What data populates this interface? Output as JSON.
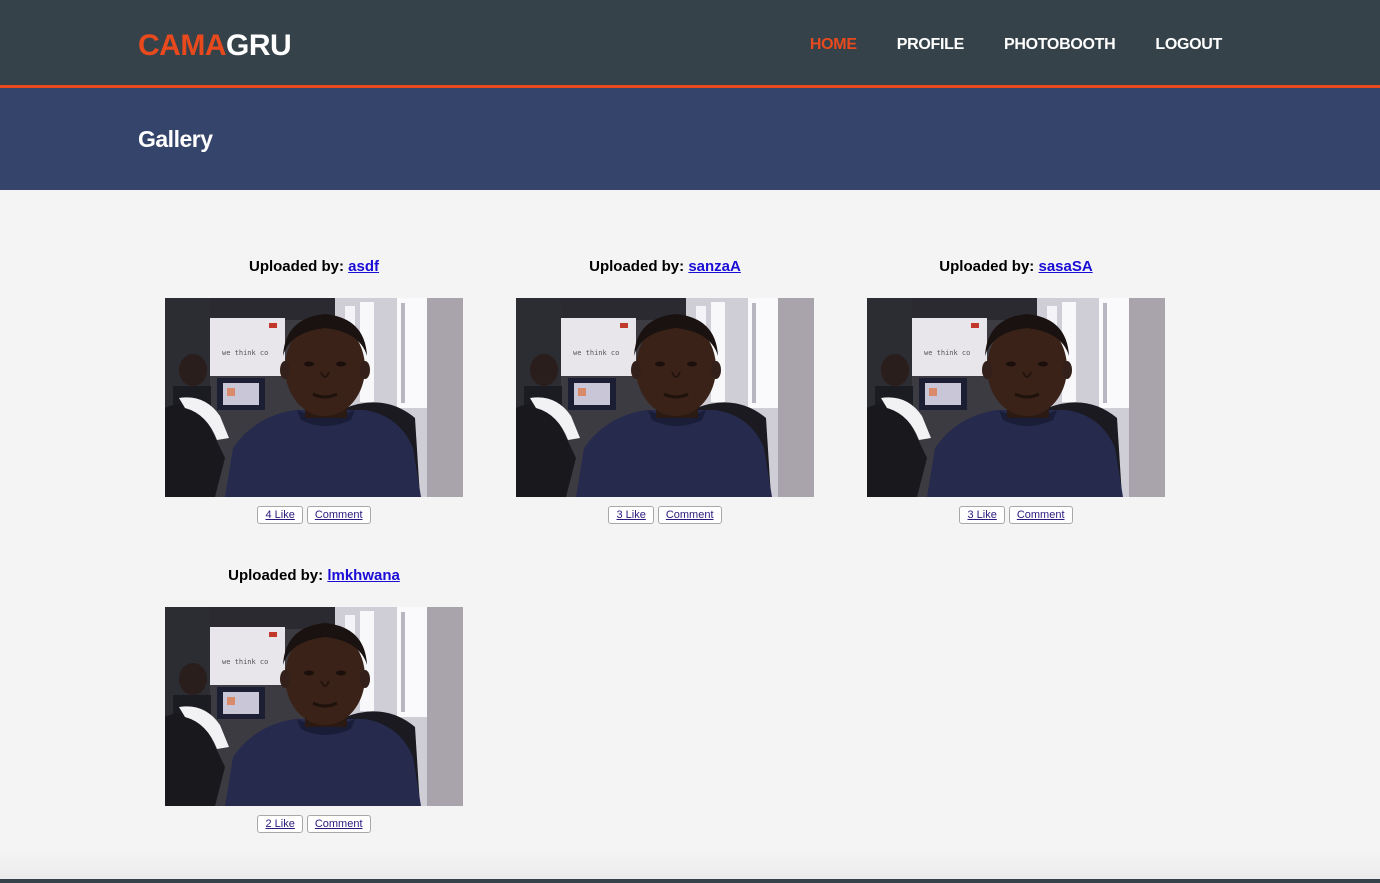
{
  "header": {
    "logo_highlight": "CAMA",
    "logo_rest": "GRU",
    "nav": [
      {
        "label": "HOME"
      },
      {
        "label": "PROFILE"
      },
      {
        "label": "PHOTOBOOTH"
      },
      {
        "label": "LOGOUT"
      }
    ]
  },
  "banner": {
    "title": "Gallery"
  },
  "gallery": {
    "items": [
      {
        "prefix": "Uploaded by:",
        "user": "asdf",
        "like_label": "4 Like",
        "comment_label": "Comment"
      },
      {
        "prefix": "Uploaded by:",
        "user": "sanzaA",
        "like_label": "3 Like",
        "comment_label": "Comment"
      },
      {
        "prefix": "Uploaded by:",
        "user": "sasaSA",
        "like_label": "3 Like",
        "comment_label": "Comment"
      },
      {
        "prefix": "Uploaded by:",
        "user": "lmkhwana",
        "like_label": "2 Like",
        "comment_label": "Comment"
      }
    ]
  },
  "photo": {
    "whiteboard_text": "we think co"
  },
  "colors": {
    "accent": "#e8491d",
    "header_bg": "#35424a",
    "banner_bg": "#35446a",
    "page_bg": "#f4f4f4",
    "link": "#1a0dd6"
  }
}
